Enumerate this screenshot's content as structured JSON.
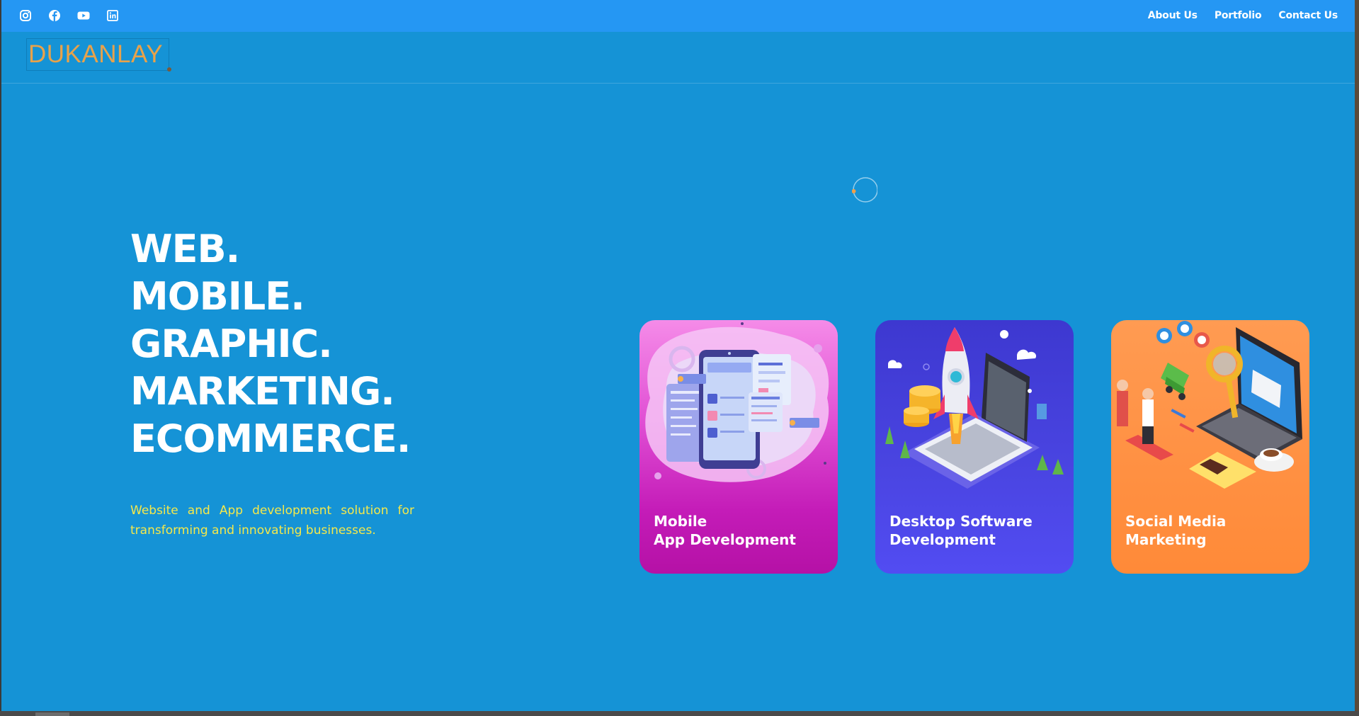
{
  "social": {
    "icons": [
      "instagram-icon",
      "facebook-icon",
      "youtube-icon",
      "linkedin-icon"
    ]
  },
  "nav": {
    "items": [
      "About Us",
      "Portfolio",
      "Contact Us"
    ]
  },
  "logo": {
    "text": "DUKANLAY"
  },
  "hero": {
    "lines": [
      "WEB.",
      "MOBILE.",
      "GRAPHIC.",
      "MARKETING.",
      "ECOMMERCE."
    ],
    "tagline": "Website and App development solution for transforming and innovating businesses."
  },
  "cards": [
    {
      "title_line1": "Mobile",
      "title_line2": "App Development",
      "icon": "mobile-app-illustration"
    },
    {
      "title_line1": "Desktop Software",
      "title_line2": "Development",
      "icon": "rocket-laptop-illustration"
    },
    {
      "title_line1": "Social Media",
      "title_line2": "Marketing",
      "icon": "marketing-laptop-illustration"
    }
  ],
  "colors": {
    "topbar": "#2597f3",
    "page_background": "#1593d6",
    "logo": "#e8a24a",
    "tagline": "#f5e84a",
    "card_mobile": "#c41cb8",
    "card_desktop": "#4a45e2",
    "card_marketing": "#ff9042"
  }
}
